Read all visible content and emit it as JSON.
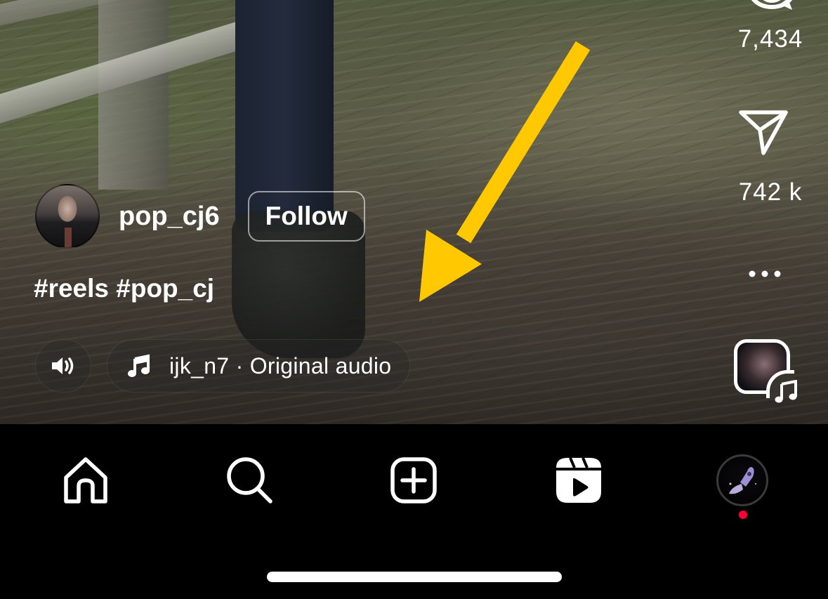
{
  "reel": {
    "author": {
      "username": "pop_cj6",
      "follow_label": "Follow"
    },
    "caption": "#reels #pop_cj",
    "audio": {
      "label": "ijk_n7 · Original audio"
    },
    "actions": {
      "comments_count": "7,434",
      "shares_count": "742 k"
    }
  },
  "icons": {
    "comment": "comment-icon",
    "share": "paper-plane-icon",
    "more": "more-horizontal-icon",
    "sound": "speaker-icon",
    "music_note": "music-note-icon",
    "audio_thumbnail": "audio-thumbnail"
  },
  "annotation": {
    "type": "arrow",
    "color": "#FFC800"
  },
  "nav": {
    "items": [
      {
        "name": "home",
        "icon": "home-icon"
      },
      {
        "name": "search",
        "icon": "search-icon"
      },
      {
        "name": "create",
        "icon": "plus-square-icon"
      },
      {
        "name": "reels",
        "icon": "reels-icon"
      },
      {
        "name": "profile",
        "icon": "profile-avatar"
      }
    ],
    "notification_dot_color": "#FF0033"
  },
  "colors": {
    "text": "#FFFFFF",
    "nav_background": "#000000",
    "arrow": "#FFC800"
  }
}
